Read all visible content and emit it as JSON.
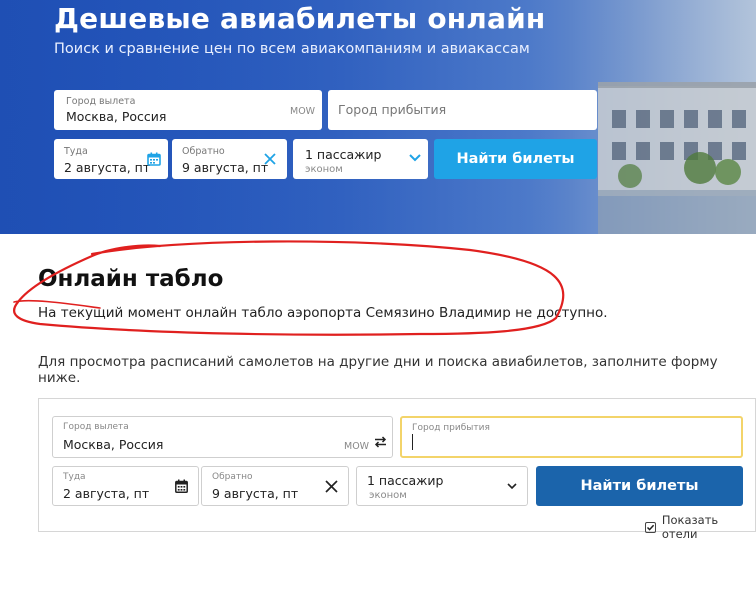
{
  "hero": {
    "title": "Дешевые авиабилеты онлайн",
    "subtitle": "Поиск и сравнение цен по всем авиакомпаниям и авиакассам",
    "form": {
      "origin_label": "Город вылета",
      "origin_value": "Москва, Россия",
      "origin_code": "MOW",
      "destination_placeholder": "Город прибытия",
      "depart_label": "Туда",
      "depart_value": "2 августа, пт",
      "return_label": "Обратно",
      "return_value": "9 августа, пт",
      "passengers_value": "1 пассажир",
      "class_value": "эконом",
      "search_button": "Найти билеты"
    }
  },
  "board": {
    "title": "Онлайн табло",
    "notice": "На текущий момент онлайн табло аэропорта Семязино Владимир не доступно.",
    "hint": "Для просмотра расписаний самолетов на другие дни и поиска авиабилетов, заполните форму ниже."
  },
  "search_form": {
    "origin_label": "Город вылета",
    "origin_value": "Москва, Россия",
    "origin_code": "MOW",
    "destination_label": "Город прибытия",
    "depart_label": "Туда",
    "depart_value": "2 августа, пт",
    "return_label": "Обратно",
    "return_value": "9 августа, пт",
    "passengers_value": "1 пассажир",
    "class_value": "эконом",
    "search_button": "Найти билеты",
    "show_hotels_label": "Показать отели",
    "show_hotels_checked": true
  },
  "colors": {
    "hero_blue": "#2457bd",
    "top_button": "#1fa3e6",
    "bottom_button": "#1b64ab",
    "annotation_red": "#e0201f",
    "active_field_border": "#f3d46a"
  }
}
